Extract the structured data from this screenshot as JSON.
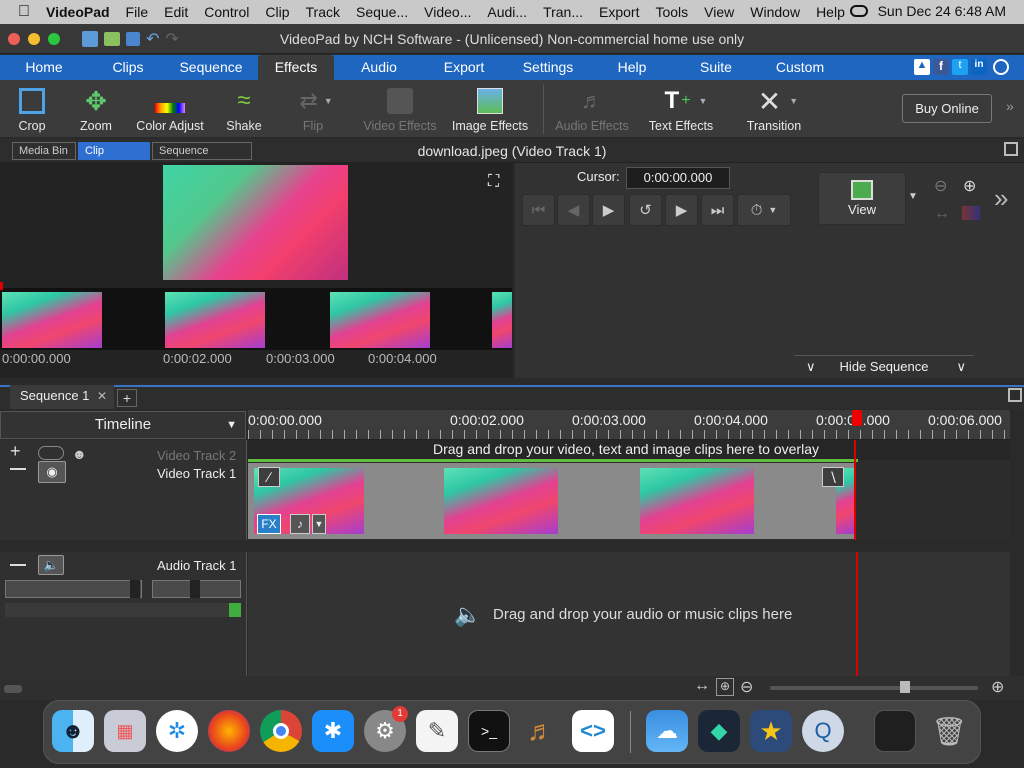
{
  "menubar": {
    "apple": "",
    "items": [
      "VideoPad",
      "File",
      "Edit",
      "Control",
      "Clip",
      "Track",
      "Seque...",
      "Video...",
      "Audi...",
      "Tran...",
      "Export",
      "Tools",
      "View",
      "Window",
      "Help"
    ],
    "clock": "Sun Dec 24  6:48 AM"
  },
  "window": {
    "title": "VideoPad by NCH Software - (Unlicensed) Non-commercial home use only"
  },
  "tabs": [
    "Home",
    "Clips",
    "Sequence",
    "Effects",
    "Audio",
    "Export",
    "Settings",
    "Help",
    "Suite",
    "Custom"
  ],
  "toolbar": {
    "crop": "Crop",
    "zoom": "Zoom",
    "color_adjust": "Color Adjust",
    "shake": "Shake",
    "flip": "Flip",
    "video_effects": "Video Effects",
    "image_effects": "Image Effects",
    "audio_effects": "Audio Effects",
    "text_effects": "Text Effects",
    "transition": "Transition",
    "buy_online": "Buy Online"
  },
  "subbar": {
    "media_bin": "Media Bin",
    "clip_preview": "Clip Preview",
    "sequence_preview": "Sequence Preview"
  },
  "clip_title": "download.jpeg (Video Track 1)",
  "strip_timecodes": [
    "0:00:00.000",
    "0:00:02.000",
    "0:00:03.000",
    "0:00:04.000"
  ],
  "player": {
    "cursor_label": "Cursor:",
    "cursor_value": "0:00:00.000",
    "view_label": "View",
    "hide_sequence": "Hide Sequence"
  },
  "sequence": {
    "tab": "Sequence 1",
    "add": "+"
  },
  "timeline": {
    "selector": "Timeline",
    "ruler": [
      "0:00:00.000",
      "0:00:02.000",
      "0:00:03.000",
      "0:00:04.000",
      "0:00:05.000",
      "0:00:06.000"
    ],
    "overlay_hint": "Drag and drop your video, text and image clips here to overlay",
    "video_track_2": "Video Track 2",
    "video_track_1": "Video Track 1",
    "audio_track_1": "Audio Track 1",
    "audio_hint": "Drag and drop your audio or music clips here",
    "fx": "FX"
  },
  "dock": {
    "badge": "1"
  }
}
